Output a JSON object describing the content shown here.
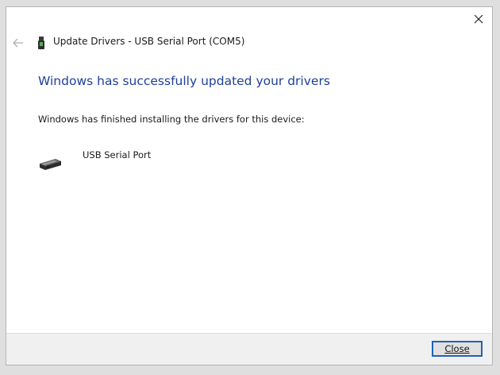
{
  "window": {
    "close_icon": "close-icon"
  },
  "header": {
    "back_icon": "back-arrow-icon",
    "device_icon": "usb-device-icon",
    "title": "Update Drivers - USB Serial Port (COM5)"
  },
  "main": {
    "heading": "Windows has successfully updated your drivers",
    "subtext": "Windows has finished installing the drivers for this device:",
    "device": {
      "icon": "usb-cable-icon",
      "name": "USB Serial Port"
    }
  },
  "footer": {
    "close_label": "Close"
  },
  "colors": {
    "heading": "#1e3f9c",
    "button_border": "#1f63b8",
    "footer_bg": "#f0f0f0"
  }
}
